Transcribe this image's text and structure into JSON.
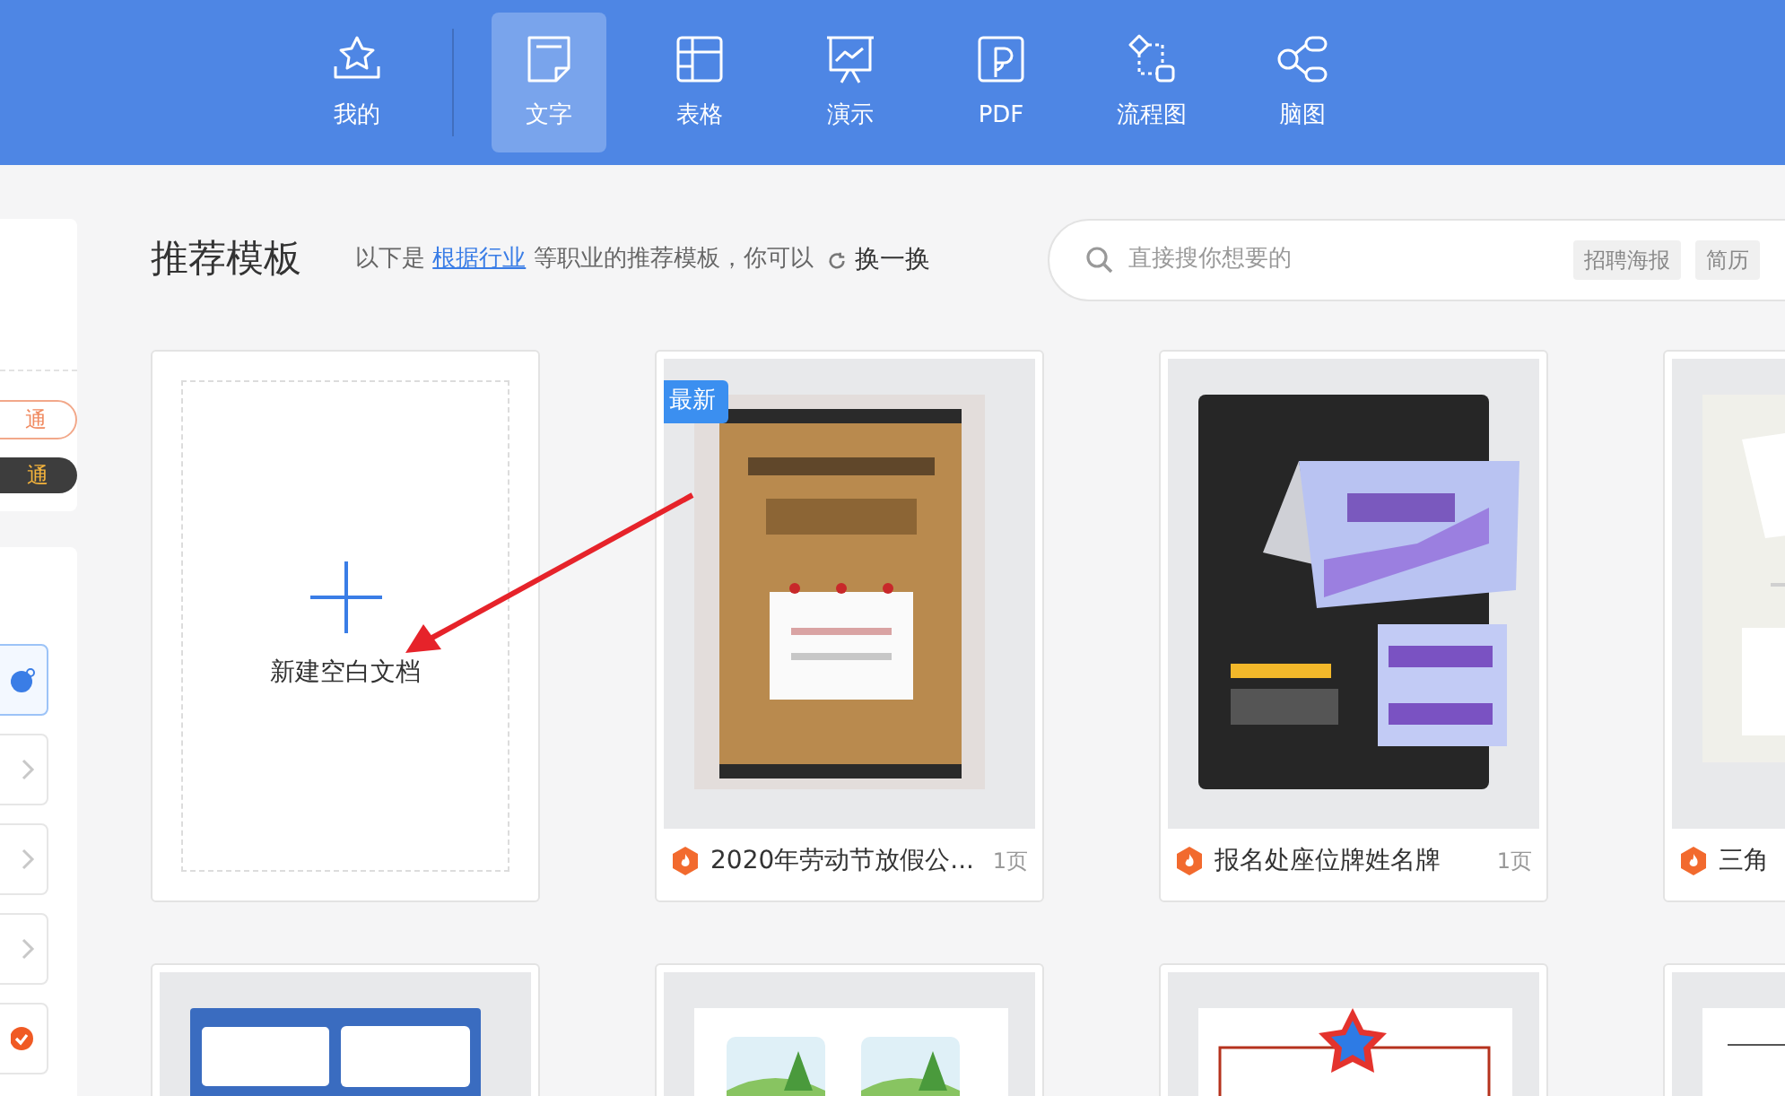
{
  "nav": {
    "items": [
      {
        "label": "我的",
        "selected": false
      },
      {
        "label": "文字",
        "selected": true
      },
      {
        "label": "表格",
        "selected": false
      },
      {
        "label": "演示",
        "selected": false
      },
      {
        "label": "PDF",
        "selected": false
      },
      {
        "label": "流程图",
        "selected": false
      },
      {
        "label": "脑图",
        "selected": false
      }
    ]
  },
  "sidebar": {
    "badges": [
      {
        "label": "通",
        "kind": "outline"
      },
      {
        "label": "通",
        "kind": "dark"
      }
    ],
    "items": [
      {
        "kind": "blue",
        "selected": true
      },
      {
        "kind": "chevron",
        "selected": false
      },
      {
        "kind": "chevron",
        "selected": false
      },
      {
        "kind": "chevron",
        "selected": false
      },
      {
        "kind": "orange",
        "selected": false
      }
    ]
  },
  "section": {
    "title": "推荐模板",
    "subtitle_before": "以下是 ",
    "subtitle_link": "根据行业",
    "subtitle_after": " 等职业的推荐模板，你可以",
    "refresh": "换一换"
  },
  "search": {
    "placeholder": "直接搜你想要的",
    "tags": [
      "招聘海报",
      "简历"
    ]
  },
  "new_doc": {
    "label": "新建空白文档"
  },
  "templates": [
    {
      "badge": "最新",
      "title": "2020年劳动节放假公...",
      "pages": "1页"
    },
    {
      "title": "报名处座位牌姓名牌",
      "pages": "1页"
    },
    {
      "title": "三角"
    },
    {
      "kind": "picture"
    },
    {
      "kind": "picture"
    },
    {
      "kind": "picture"
    },
    {
      "kind": "picture"
    }
  ]
}
